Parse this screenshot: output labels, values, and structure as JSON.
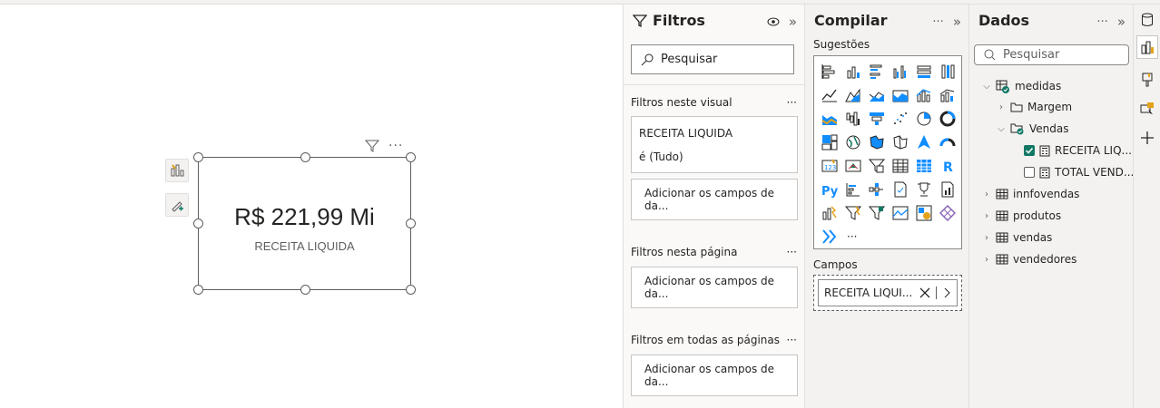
{
  "canvas": {
    "card": {
      "value": "R$ 221,99 Mi",
      "label": "RECEITA LIQUIDA"
    },
    "more_label": "···"
  },
  "filters": {
    "title": "Filtros",
    "search_placeholder": "Pesquisar",
    "visual_section": "Filtros neste visual",
    "field_name": "RECEITA LIQUIDA",
    "field_condition": "é (Tudo)",
    "add_fields": "Adicionar os campos de da...",
    "page_section": "Filtros nesta página",
    "all_pages_section": "Filtros em todas as páginas",
    "more": "···"
  },
  "build": {
    "title": "Compilar",
    "suggestions": "Sugestões",
    "fields_label": "Campos",
    "field_pill": "RECEITA LIQUI...",
    "more": "···"
  },
  "data": {
    "title": "Dados",
    "search_placeholder": "Pesquisar",
    "more": "···",
    "tree": {
      "medidas": "medidas",
      "margem": "Margem",
      "vendas_folder": "Vendas",
      "receita": "RECEITA LIQ...",
      "total": "TOTAL VEND...",
      "innfovendas": "innfovendas",
      "produtos": "produtos",
      "vendas": "vendas",
      "vendedores": "vendedores"
    }
  },
  "visual_icons": [
    "stacked-bar-icon",
    "stacked-column-icon",
    "clustered-bar-icon",
    "clustered-column-icon",
    "100-bar-icon",
    "100-column-icon",
    "line-chart-icon",
    "area-chart-icon",
    "stacked-area-icon",
    "100-area-icon",
    "line-column-icon",
    "line-clustered-icon",
    "ribbon-chart-icon",
    "waterfall-icon",
    "funnel-icon",
    "scatter-icon",
    "pie-icon",
    "donut-icon",
    "treemap-icon",
    "map-icon",
    "filled-map-icon",
    "shape-map-icon",
    "azure-map-icon",
    "gauge-icon",
    "card-icon",
    "kpi-icon",
    "slicer-icon",
    "table-icon",
    "matrix-icon",
    "r-visual-icon",
    "python-visual-icon",
    "key-influencers-icon",
    "decomposition-tree-icon",
    "qa-icon",
    "smart-narrative-icon",
    "paginated-report-icon",
    "power-apps-icon",
    "power-automate-icon",
    "metrics-icon",
    "arcgis-icon",
    "custom-visual-icon",
    "diamond-visual-icon",
    "get-more-visuals-icon",
    "more-visuals-icon"
  ]
}
